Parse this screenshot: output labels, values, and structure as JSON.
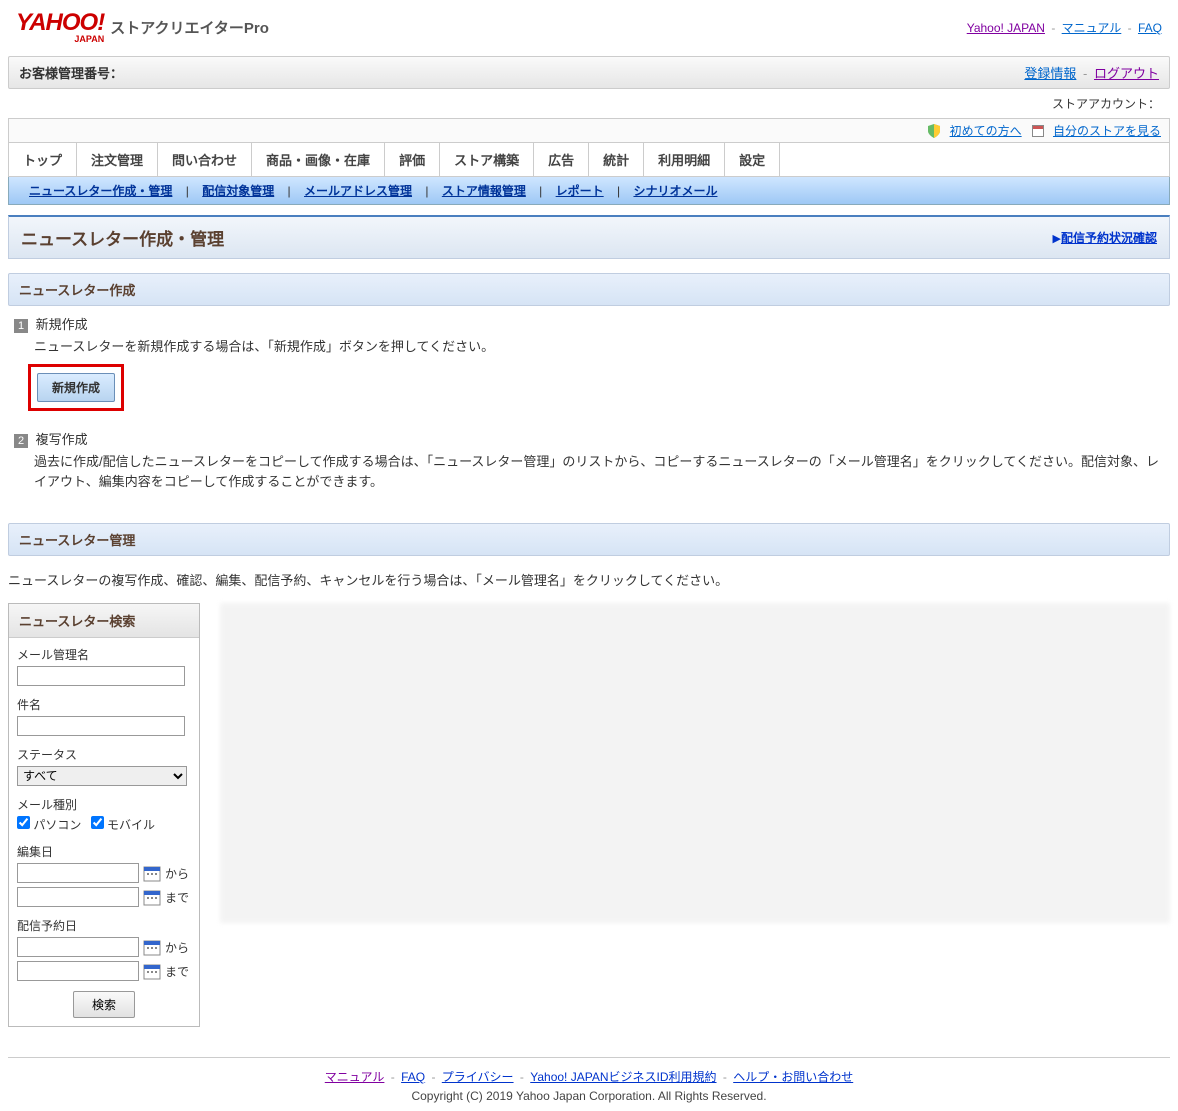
{
  "header": {
    "logo_main": "YAHOO!",
    "logo_sub": "JAPAN",
    "app_title": "ストアクリエイターPro",
    "links": {
      "yj": "Yahoo! JAPAN",
      "manual": "マニュアル",
      "faq": "FAQ"
    }
  },
  "account_bar": {
    "label": "お客様管理番号：",
    "reg_info": "登録情報",
    "logout": "ログアウト"
  },
  "store_account_label": "ストアアカウント：",
  "util_bar": {
    "beginner": "初めての方へ",
    "view_store": "自分のストアを見る"
  },
  "main_nav": [
    "トップ",
    "注文管理",
    "問い合わせ",
    "商品・画像・在庫",
    "評価",
    "ストア構築",
    "広告",
    "統計",
    "利用明細",
    "設定"
  ],
  "sub_nav": [
    "ニュースレター作成・管理",
    "配信対象管理",
    "メールアドレス管理",
    "ストア情報管理",
    "レポート",
    "シナリオメール"
  ],
  "page_title": "ニュースレター作成・管理",
  "reserve_link": "配信予約状況確認",
  "section_create": "ニュースレター作成",
  "step1": {
    "num": "1",
    "title": "新規作成",
    "desc": "ニュースレターを新規作成する場合は、「新規作成」ボタンを押してください。",
    "button": "新規作成"
  },
  "step2": {
    "num": "2",
    "title": "複写作成",
    "desc": "過去に作成/配信したニュースレターをコピーして作成する場合は、「ニュースレター管理」のリストから、コピーするニュースレターの「メール管理名」をクリックしてください。配信対象、レイアウト、編集内容をコピーして作成することができます。"
  },
  "section_manage": "ニュースレター管理",
  "manage_desc": "ニュースレターの複写作成、確認、編集、配信予約、キャンセルを行う場合は、「メール管理名」をクリックしてください。",
  "search": {
    "title": "ニュースレター検索",
    "mail_name": "メール管理名",
    "subject": "件名",
    "status": "ステータス",
    "status_opt": "すべて",
    "mail_type": "メール種別",
    "pc": "パソコン",
    "mobile": "モバイル",
    "edit_date": "編集日",
    "reserve_date": "配信予約日",
    "from": "から",
    "to": "まで",
    "button": "検索"
  },
  "footer": {
    "manual": "マニュアル",
    "faq": "FAQ",
    "privacy": "プライバシー",
    "terms": "Yahoo! JAPANビジネスID利用規約",
    "help": "ヘルプ・お問い合わせ",
    "copyright": "Copyright (C) 2019 Yahoo Japan Corporation. All Rights Reserved."
  }
}
